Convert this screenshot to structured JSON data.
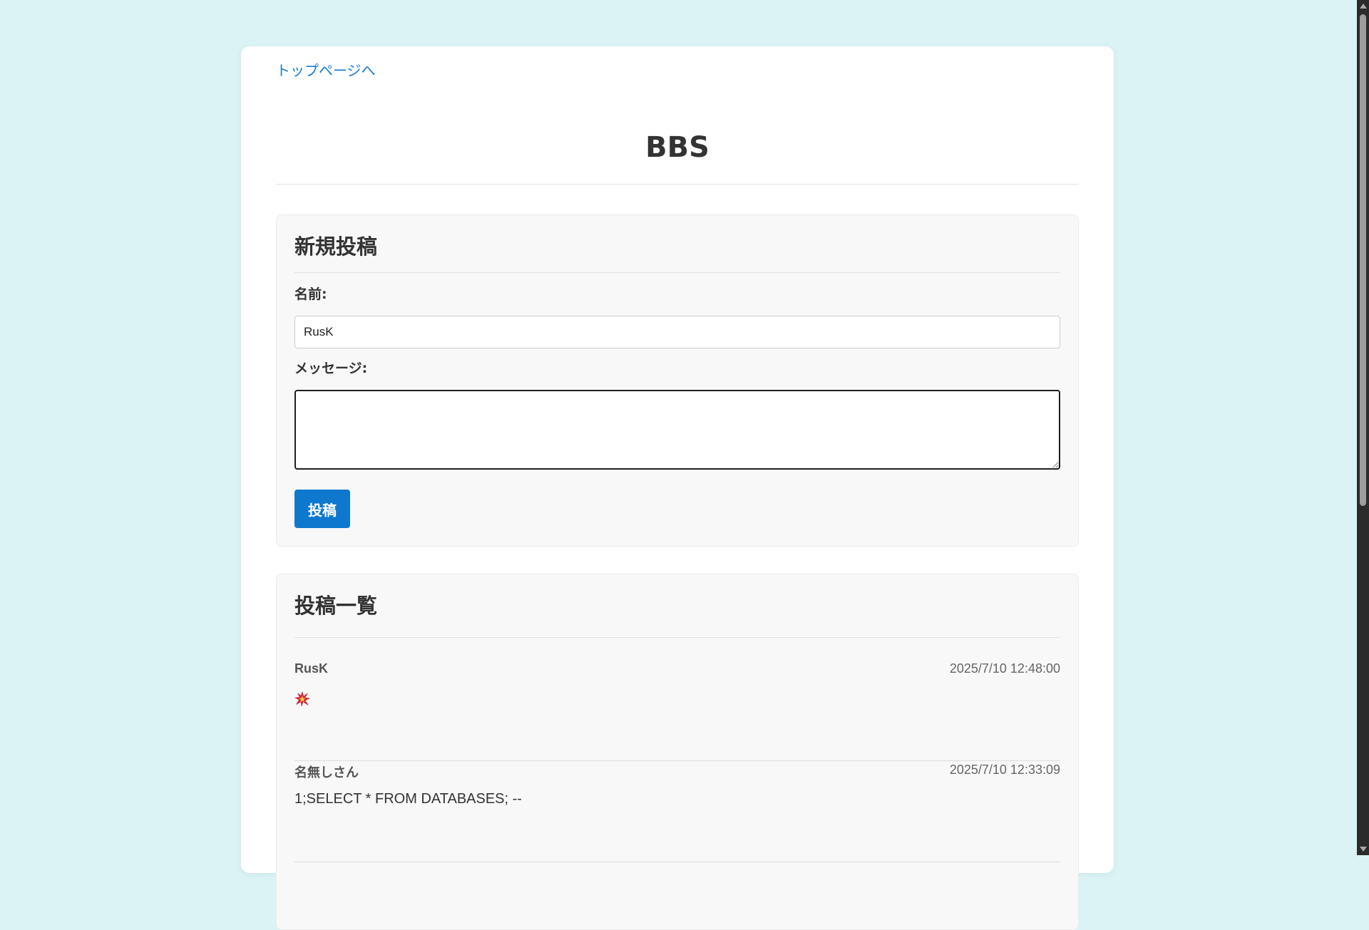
{
  "nav": {
    "top_link": "トップページへ"
  },
  "header": {
    "title": "BBS"
  },
  "post_form": {
    "heading": "新規投稿",
    "name_label": "名前:",
    "name_value": "RusK",
    "message_label": "メッセージ:",
    "message_value": "",
    "submit_label": "投稿"
  },
  "post_list": {
    "heading": "投稿一覧",
    "posts": [
      {
        "author": "RusK",
        "timestamp": "2025/7/10 12:48:00",
        "message": "💥"
      },
      {
        "author": "名無しさん",
        "timestamp": "2025/7/10 12:33:09",
        "message": "1;SELECT * FROM DATABASES; --"
      }
    ]
  },
  "colors": {
    "page_background": "#dbf3f5",
    "accent": "#0e78cf",
    "link": "#1a7bd0",
    "burst_icon": "#e0243b"
  }
}
